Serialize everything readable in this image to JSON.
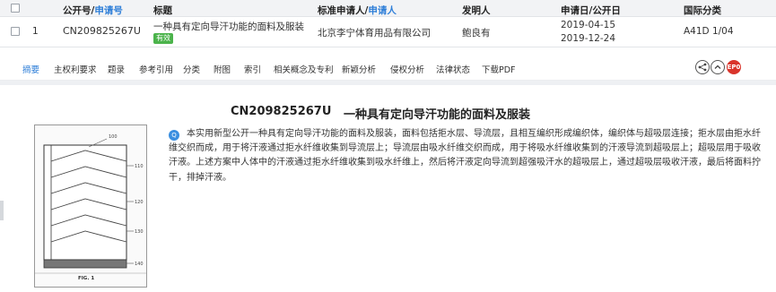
{
  "table": {
    "headers": {
      "pub_no_a": "公开号/",
      "pub_no_b": "申请号",
      "title": "标题",
      "applicant_a": "标准申请人/",
      "applicant_b": "申请人",
      "inventor": "发明人",
      "date": "申请日/公开日",
      "ipc": "国际分类"
    },
    "row": {
      "index": "1",
      "pub_no": "CN209825267U",
      "title": "一种具有定向导汗功能的面料及服装",
      "status": "有效",
      "applicant": "北京李宁体育用品有限公司",
      "inventor": "鲍良有",
      "app_date": "2019-04-15",
      "pub_date": "2019-12-24",
      "ipc": "A41D 1/04"
    }
  },
  "tabs": [
    "摘要",
    "主权利要求",
    "题录",
    "参考引用",
    "分类",
    "附图",
    "索引",
    "相关概念及专利",
    "新颖分析",
    "侵权分析",
    "法律状态",
    "下载PDF"
  ],
  "actions": {
    "ep_label": "EP0"
  },
  "detail": {
    "pub_no": "CN209825267U",
    "title": "一种具有定向导汗功能的面料及服装",
    "abstract": "本实用新型公开一种具有定向导汗功能的面料及服装，面料包括拒水层、导流层，且相互编织形成编织体，编织体与超吸层连接；拒水层由拒水纤维交织而成，用于将汗液通过拒水纤维收集到导流层上；导流层由吸水纤维交织而成，用于将吸水纤维收集到的汗液导流到超吸层上；超吸层用于吸收汗液。上述方案中人体中的汗液通过拒水纤维收集到吸水纤维上，然后将汗液定向导流到超强吸汗水的超吸层上，通过超吸层吸收汗液，最后将面料拧干，排掉汗液。",
    "figure": {
      "ref_top": "100",
      "ref_1": "110",
      "ref_2": "120",
      "ref_3": "130",
      "ref_bottom": "140",
      "caption": "FIG. 1"
    }
  }
}
